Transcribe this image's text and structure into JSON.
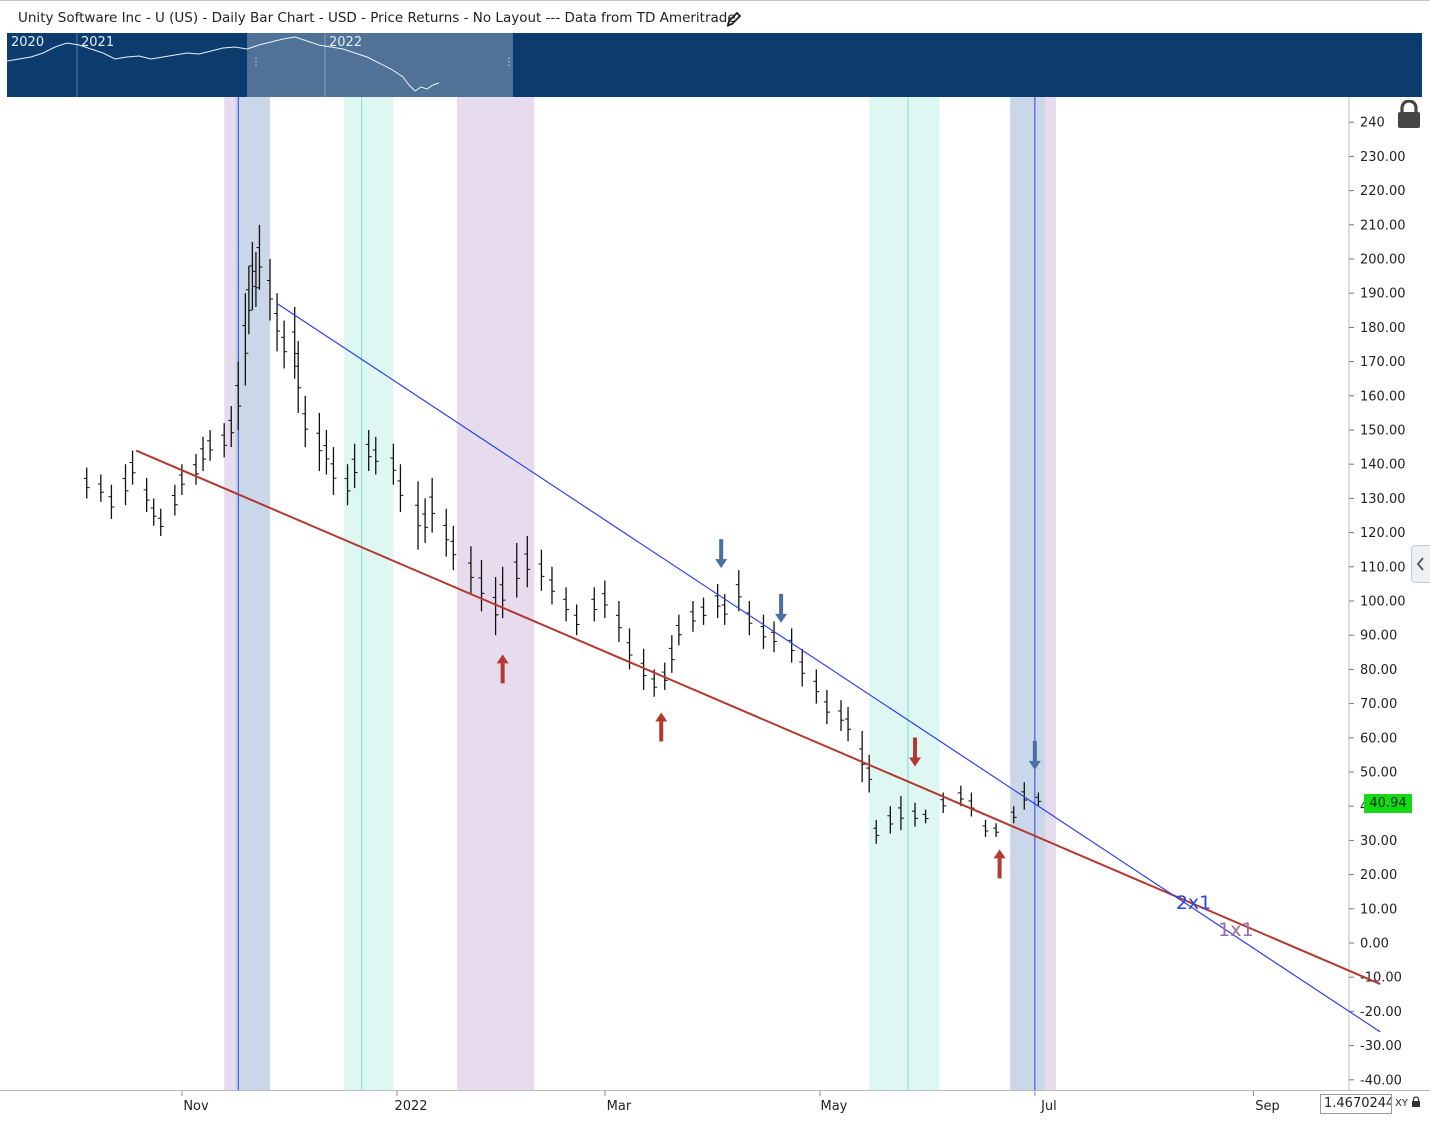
{
  "header": {
    "title": "Unity Software Inc - U (US) - Daily Bar Chart - USD - Price Returns - No Layout --- Data from TD Ameritrade"
  },
  "navigator": {
    "years": [
      "2020",
      "2021",
      "2022"
    ]
  },
  "price_badge": "40.94",
  "scale_field": "1.4670244",
  "xy_label": "XY",
  "chart_data": {
    "type": "bar",
    "subtype": "ohlc",
    "title": "",
    "xlabel": "",
    "ylabel": "",
    "ylim": [
      -42,
      245
    ],
    "y_ticks": [
      "240",
      "230.00",
      "220.00",
      "210.00",
      "200.00",
      "190.00",
      "180.00",
      "170.00",
      "160.00",
      "150.00",
      "140.00",
      "130.00",
      "120.00",
      "110.00",
      "100.00",
      "90.00",
      "80.00",
      "70.00",
      "60.00",
      "50.00",
      "40.00",
      "30.00",
      "20.00",
      "10.00",
      "0.00",
      "-10.00",
      "-20.00",
      "-30.00",
      "-40.00"
    ],
    "x_ticks": [
      "Nov",
      "2022",
      "Mar",
      "May",
      "Jul",
      "Sep"
    ],
    "last_price": 40.94,
    "grid": false,
    "series": [
      {
        "values": [
          {
            "date": "2021-10-01",
            "high": 139,
            "low": 130
          },
          {
            "date": "2021-10-05",
            "high": 137,
            "low": 129
          },
          {
            "date": "2021-10-08",
            "high": 134,
            "low": 124
          },
          {
            "date": "2021-10-12",
            "high": 140,
            "low": 128
          },
          {
            "date": "2021-10-14",
            "high": 144,
            "low": 134
          },
          {
            "date": "2021-10-18",
            "high": 136,
            "low": 126
          },
          {
            "date": "2021-10-20",
            "high": 130,
            "low": 122
          },
          {
            "date": "2021-10-22",
            "high": 127,
            "low": 119
          },
          {
            "date": "2021-10-26",
            "high": 134,
            "low": 125
          },
          {
            "date": "2021-10-28",
            "high": 140,
            "low": 131
          },
          {
            "date": "2021-11-01",
            "high": 143,
            "low": 134
          },
          {
            "date": "2021-11-03",
            "high": 148,
            "low": 138
          },
          {
            "date": "2021-11-05",
            "high": 150,
            "low": 141
          },
          {
            "date": "2021-11-09",
            "high": 152,
            "low": 142
          },
          {
            "date": "2021-11-11",
            "high": 157,
            "low": 145
          },
          {
            "date": "2021-11-13",
            "high": 170,
            "low": 150
          },
          {
            "date": "2021-11-15",
            "high": 190,
            "low": 163
          },
          {
            "date": "2021-11-16",
            "high": 198,
            "low": 178
          },
          {
            "date": "2021-11-17",
            "high": 205,
            "low": 185
          },
          {
            "date": "2021-11-18",
            "high": 202,
            "low": 186
          },
          {
            "date": "2021-11-19",
            "high": 210,
            "low": 191
          },
          {
            "date": "2021-11-22",
            "high": 200,
            "low": 182
          },
          {
            "date": "2021-11-24",
            "high": 190,
            "low": 173
          },
          {
            "date": "2021-11-26",
            "high": 182,
            "low": 168
          },
          {
            "date": "2021-11-29",
            "high": 186,
            "low": 165
          },
          {
            "date": "2021-11-30",
            "high": 176,
            "low": 155
          },
          {
            "date": "2021-12-02",
            "high": 160,
            "low": 145
          },
          {
            "date": "2021-12-06",
            "high": 155,
            "low": 138
          },
          {
            "date": "2021-12-08",
            "high": 150,
            "low": 137
          },
          {
            "date": "2021-12-10",
            "high": 145,
            "low": 131
          },
          {
            "date": "2021-12-14",
            "high": 140,
            "low": 128
          },
          {
            "date": "2021-12-16",
            "high": 146,
            "low": 133
          },
          {
            "date": "2021-12-20",
            "high": 150,
            "low": 138
          },
          {
            "date": "2021-12-22",
            "high": 148,
            "low": 137
          },
          {
            "date": "2021-12-27",
            "high": 146,
            "low": 134
          },
          {
            "date": "2021-12-29",
            "high": 140,
            "low": 126
          },
          {
            "date": "2022-01-03",
            "high": 135,
            "low": 115
          },
          {
            "date": "2022-01-05",
            "high": 130,
            "low": 117
          },
          {
            "date": "2022-01-07",
            "high": 136,
            "low": 120
          },
          {
            "date": "2022-01-11",
            "high": 127,
            "low": 113
          },
          {
            "date": "2022-01-13",
            "high": 122,
            "low": 109
          },
          {
            "date": "2022-01-18",
            "high": 116,
            "low": 102
          },
          {
            "date": "2022-01-21",
            "high": 112,
            "low": 97
          },
          {
            "date": "2022-01-25",
            "high": 107,
            "low": 90
          },
          {
            "date": "2022-01-27",
            "high": 110,
            "low": 95
          },
          {
            "date": "2022-01-31",
            "high": 117,
            "low": 101
          },
          {
            "date": "2022-02-03",
            "high": 119,
            "low": 104
          },
          {
            "date": "2022-02-07",
            "high": 115,
            "low": 103
          },
          {
            "date": "2022-02-10",
            "high": 110,
            "low": 99
          },
          {
            "date": "2022-02-14",
            "high": 104,
            "low": 94
          },
          {
            "date": "2022-02-17",
            "high": 99,
            "low": 90
          },
          {
            "date": "2022-02-22",
            "high": 104,
            "low": 94
          },
          {
            "date": "2022-02-25",
            "high": 106,
            "low": 95
          },
          {
            "date": "2022-03-01",
            "high": 100,
            "low": 88
          },
          {
            "date": "2022-03-04",
            "high": 92,
            "low": 80
          },
          {
            "date": "2022-03-08",
            "high": 86,
            "low": 74
          },
          {
            "date": "2022-03-11",
            "high": 80,
            "low": 72
          },
          {
            "date": "2022-03-14",
            "high": 82,
            "low": 74
          },
          {
            "date": "2022-03-16",
            "high": 90,
            "low": 79
          },
          {
            "date": "2022-03-18",
            "high": 96,
            "low": 87
          },
          {
            "date": "2022-03-22",
            "high": 100,
            "low": 91
          },
          {
            "date": "2022-03-25",
            "high": 101,
            "low": 93
          },
          {
            "date": "2022-03-29",
            "high": 105,
            "low": 95
          },
          {
            "date": "2022-03-31",
            "high": 102,
            "low": 93
          },
          {
            "date": "2022-04-04",
            "high": 109,
            "low": 97
          },
          {
            "date": "2022-04-07",
            "high": 100,
            "low": 90
          },
          {
            "date": "2022-04-11",
            "high": 96,
            "low": 86
          },
          {
            "date": "2022-04-14",
            "high": 94,
            "low": 85
          },
          {
            "date": "2022-04-19",
            "high": 92,
            "low": 82
          },
          {
            "date": "2022-04-22",
            "high": 86,
            "low": 75
          },
          {
            "date": "2022-04-26",
            "high": 80,
            "low": 70
          },
          {
            "date": "2022-04-29",
            "high": 74,
            "low": 64
          },
          {
            "date": "2022-05-03",
            "high": 71,
            "low": 62
          },
          {
            "date": "2022-05-05",
            "high": 69,
            "low": 59
          },
          {
            "date": "2022-05-09",
            "high": 62,
            "low": 47
          },
          {
            "date": "2022-05-11",
            "high": 55,
            "low": 44
          },
          {
            "date": "2022-05-13",
            "high": 36,
            "low": 29
          },
          {
            "date": "2022-05-17",
            "high": 40,
            "low": 32
          },
          {
            "date": "2022-05-20",
            "high": 43,
            "low": 33
          },
          {
            "date": "2022-05-24",
            "high": 41,
            "low": 34
          },
          {
            "date": "2022-05-27",
            "high": 39,
            "low": 35
          },
          {
            "date": "2022-06-01",
            "high": 44,
            "low": 38
          },
          {
            "date": "2022-06-06",
            "high": 46,
            "low": 40
          },
          {
            "date": "2022-06-09",
            "high": 44,
            "low": 37
          },
          {
            "date": "2022-06-13",
            "high": 36,
            "low": 31
          },
          {
            "date": "2022-06-16",
            "high": 35,
            "low": 31
          },
          {
            "date": "2022-06-21",
            "high": 40,
            "low": 35
          },
          {
            "date": "2022-06-24",
            "high": 47,
            "low": 39
          },
          {
            "date": "2022-06-28",
            "high": 44,
            "low": 40
          }
        ]
      }
    ],
    "trendlines": [
      {
        "color": "#b23a30",
        "from": {
          "date": "2021-10-15",
          "value": 144
        },
        "to": {
          "date": "2022-10-03",
          "value": -12
        }
      },
      {
        "color": "#2d44e6",
        "from": {
          "date": "2021-11-24",
          "value": 187
        },
        "to": {
          "date": "2022-10-03",
          "value": -26
        }
      }
    ],
    "shaded_regions": [
      {
        "color": "#e6dcee",
        "from": "2021-11-09",
        "to": "2021-11-12"
      },
      {
        "color": "#c9d7e8",
        "from": "2021-11-12",
        "to": "2021-11-22"
      },
      {
        "color": "#dff7f3",
        "from": "2021-12-13",
        "to": "2021-12-27"
      },
      {
        "color": "#e6dcee",
        "from": "2022-01-14",
        "to": "2022-02-05"
      },
      {
        "color": "#dff7f3",
        "from": "2022-05-11",
        "to": "2022-05-31"
      },
      {
        "color": "#c9d7e8",
        "from": "2022-06-20",
        "to": "2022-06-30"
      },
      {
        "color": "#e6dcee",
        "from": "2022-06-30",
        "to": "2022-07-03"
      }
    ],
    "vertical_lines": [
      {
        "color": "#2d44e6",
        "date": "2021-11-13"
      },
      {
        "color": "#7fe0cf",
        "date": "2021-12-18"
      },
      {
        "color": "#7fe0cf",
        "date": "2022-05-22"
      },
      {
        "color": "#2d44e6",
        "date": "2022-06-27"
      }
    ],
    "markers": [
      {
        "kind": "up",
        "color": "#b23a30",
        "date": "2022-01-27",
        "value": 80
      },
      {
        "kind": "up",
        "color": "#b23a30",
        "date": "2022-03-13",
        "value": 63
      },
      {
        "kind": "up",
        "color": "#b23a30",
        "date": "2022-06-17",
        "value": 23
      },
      {
        "kind": "down",
        "color": "#4a6fa5",
        "date": "2022-03-30",
        "value": 114
      },
      {
        "kind": "down",
        "color": "#4a6fa5",
        "date": "2022-04-16",
        "value": 98
      },
      {
        "kind": "down",
        "color": "#b23a30",
        "date": "2022-05-24",
        "value": 56
      },
      {
        "kind": "down",
        "color": "#4a6fa5",
        "date": "2022-06-27",
        "value": 55
      }
    ],
    "annotations": [
      {
        "text": "2x1",
        "color": "#2d44e6",
        "date": "2022-08-06",
        "value": 10
      },
      {
        "text": "1x1",
        "color": "#9c6aa0",
        "date": "2022-08-18",
        "value": 2
      }
    ]
  }
}
